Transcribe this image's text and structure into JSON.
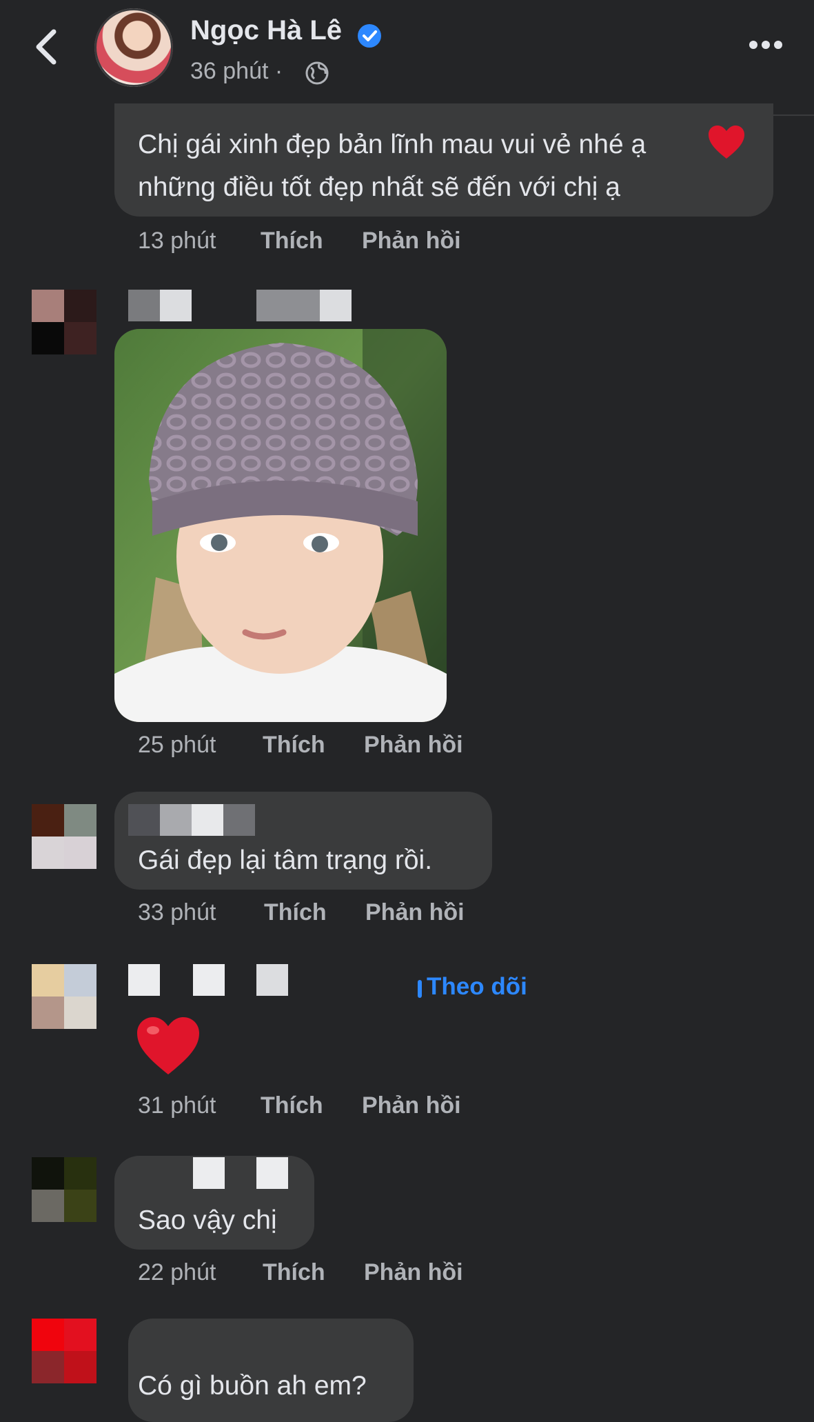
{
  "header": {
    "name": "Ngọc Hà Lê",
    "time": "36 phút ·",
    "verified_icon": "verified-badge-icon",
    "privacy_icon": "globe-icon"
  },
  "labels": {
    "like": "Thích",
    "reply": "Phản hồi"
  },
  "comments": [
    {
      "text_line1": "Chị gái xinh đẹp bản lĩnh mau vui vẻ nhé ạ",
      "text_line2": "những điều tốt đẹp nhất sẽ đến với chị ạ",
      "time": "13 phút"
    },
    {
      "time": "25 phút",
      "attachment": "photo of a girl wearing a knitted hat"
    },
    {
      "text": "Gái đẹp lại tâm trạng rồi.",
      "time": "33 phút"
    },
    {
      "follow": "Theo dõi",
      "time": "31 phút"
    },
    {
      "text": "Sao vậy chị",
      "time": "22 phút"
    },
    {
      "text": "Có gì buồn ah em?"
    }
  ],
  "colors": {
    "background": "#242527",
    "bubble": "#3a3b3c",
    "accent": "#2d88ff",
    "heart": "#e0152b"
  }
}
